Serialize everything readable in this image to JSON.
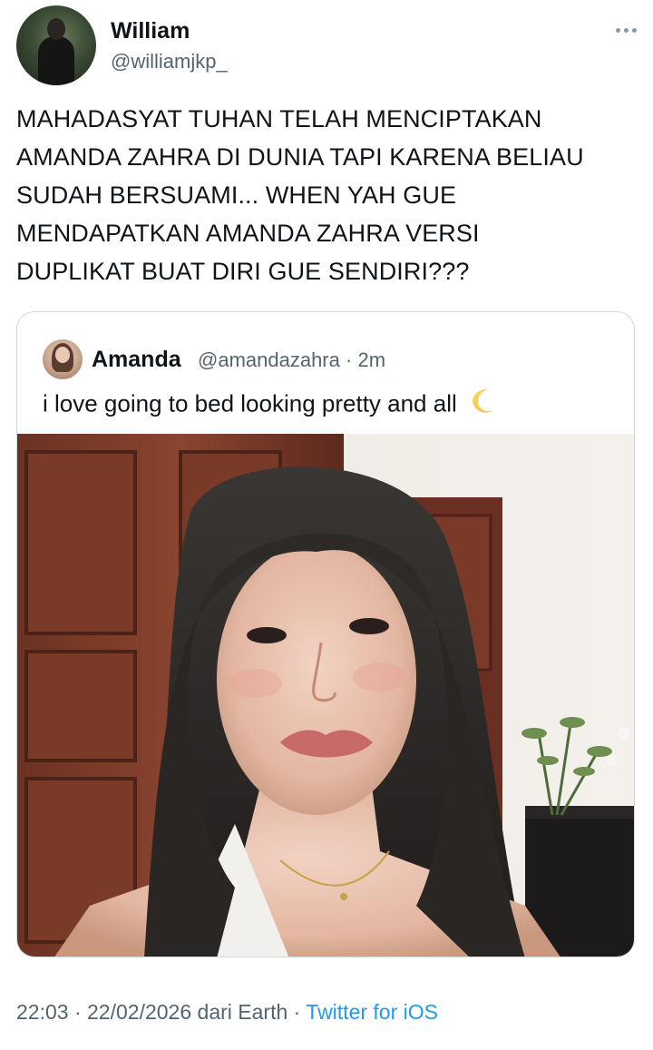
{
  "author": {
    "display_name": "William",
    "handle": "@williamjkp_"
  },
  "tweet": {
    "text_lines": [
      "MAHADASYAT TUHAN TELAH MENCIPTAKAN",
      "AMANDA ZAHRA DI DUNIA TAPI KARENA BELIAU",
      "SUDAH BERSUAMI... WHEN YAH GUE",
      "MENDAPATKAN AMANDA ZAHRA VERSI",
      "DUPLIKAT BUAT DIRI GUE SENDIRI???"
    ],
    "time": "22:03",
    "date": "22/02/2026",
    "separator": "·",
    "origin": "dari Earth",
    "source": "Twitter for iOS"
  },
  "quoted": {
    "display_name": "Amanda",
    "handle": "@amandazahra",
    "age": "2m",
    "text": "i love going to bed looking pretty and all",
    "emoji_icon": "crescent-moon-icon",
    "photo": "selfie-photo"
  },
  "icons": {
    "more": "more-options-icon"
  },
  "colors": {
    "text_primary": "#0f1419",
    "text_secondary": "#536471",
    "link": "#1d9bf0",
    "card_border": "#cfd9de"
  }
}
